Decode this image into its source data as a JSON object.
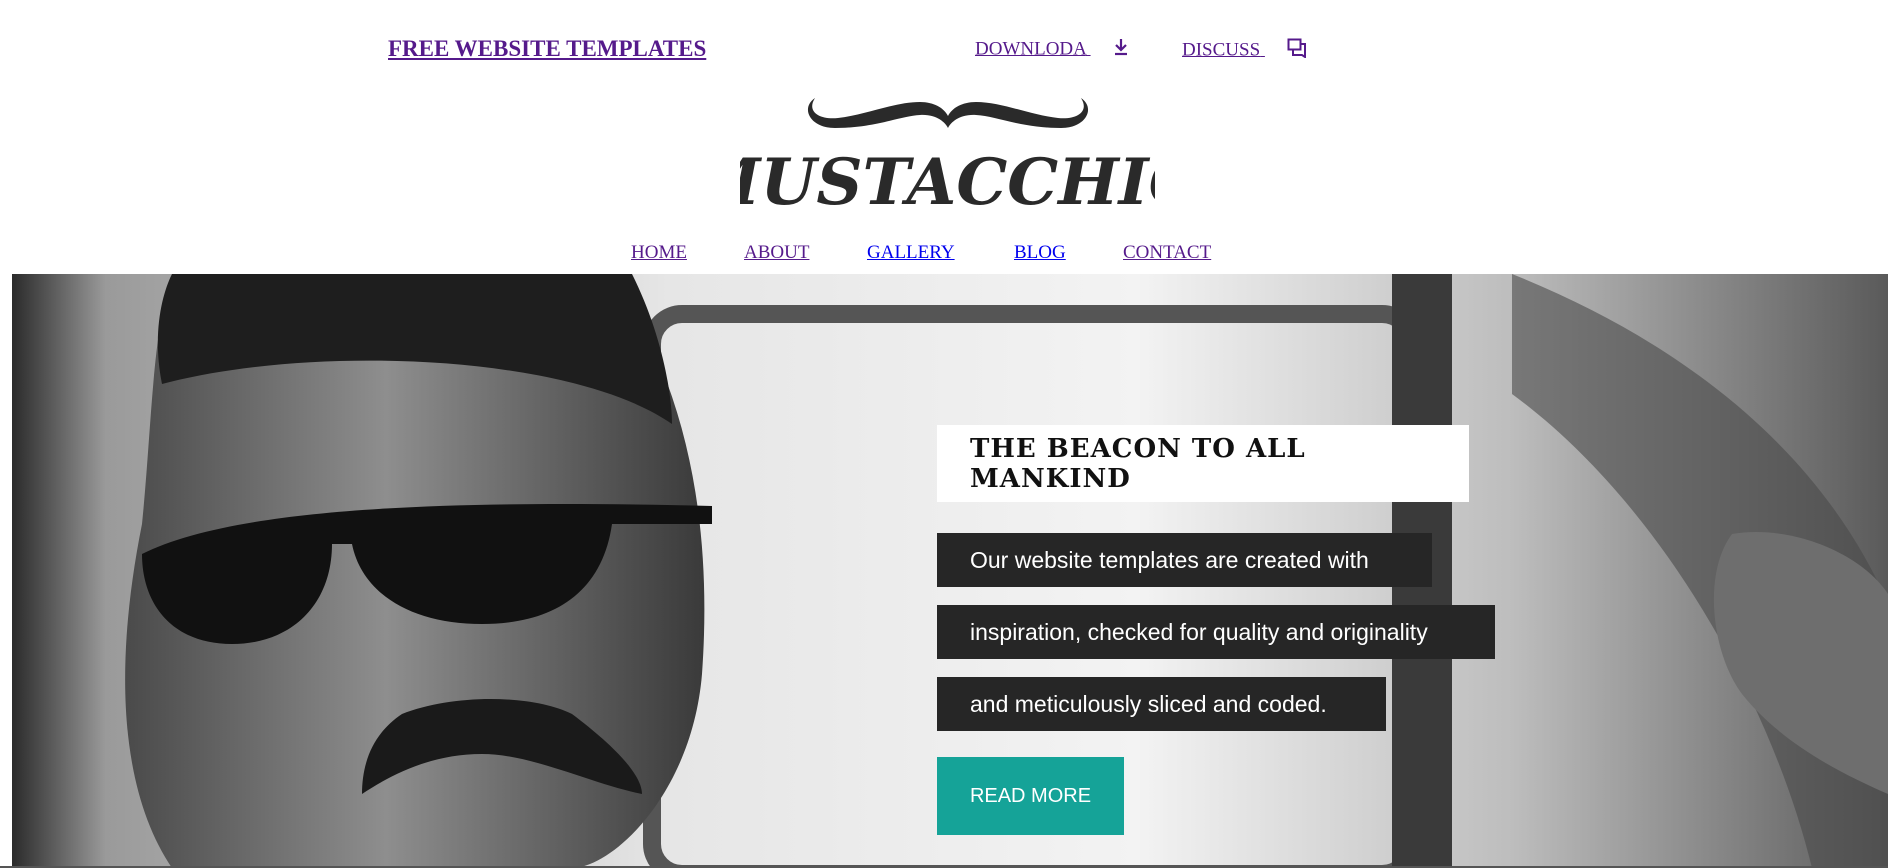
{
  "topbar": {
    "free_templates_label": "FREE WEBSITE TEMPLATES",
    "download_label": "DOWNLODA",
    "download_icon": "download-icon",
    "discuss_label": "DISCUSS",
    "discuss_icon": "chat-bubbles-icon"
  },
  "logo": {
    "text": "MUSTACCHIO",
    "icon": "mustache-icon"
  },
  "nav": {
    "items": [
      {
        "label": "HOME"
      },
      {
        "label": "ABOUT"
      },
      {
        "label": "GALLERY"
      },
      {
        "label": "BLOG"
      },
      {
        "label": "CONTACT"
      }
    ]
  },
  "hero": {
    "headline": "THE BEACON TO ALL MANKIND",
    "body_lines": [
      "Our website templates are created with",
      "inspiration, checked for quality and originality",
      "and meticulously sliced and coded."
    ],
    "cta_label": "READ MORE"
  },
  "colors": {
    "link_visited": "#551a8b",
    "link_unvisited": "#0000ee",
    "text_box_bg": "#262626",
    "cta_bg": "#15a398"
  }
}
